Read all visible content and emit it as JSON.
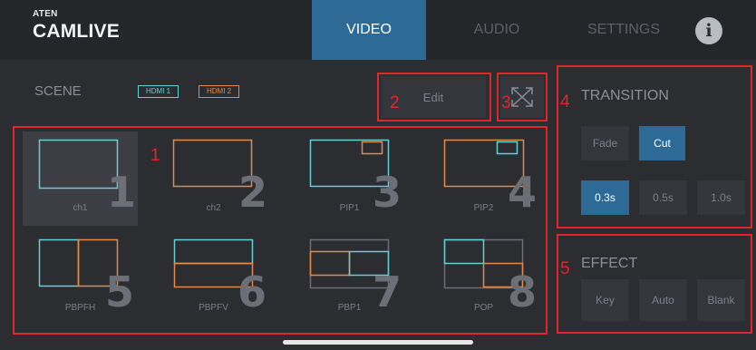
{
  "app": {
    "brand_small": "ATEN",
    "brand_name": "CAMLIVE"
  },
  "tabs": [
    {
      "label": "VIDEO",
      "active": true
    },
    {
      "label": "AUDIO",
      "active": false
    },
    {
      "label": "SETTINGS",
      "active": false
    }
  ],
  "info_icon": {
    "glyph": "i",
    "icon": "info-icon"
  },
  "scene": {
    "label": "SCENE",
    "sources": [
      {
        "label": "HDMI 1",
        "color": "#62d0d6"
      },
      {
        "label": "HDMI 2",
        "color": "#e38a4a"
      }
    ]
  },
  "edit_button": {
    "label": "Edit"
  },
  "expand_button": {
    "icon": "expand-arrows-icon"
  },
  "scenes": [
    {
      "number": "1",
      "label": "ch1",
      "selected": true,
      "layout": "full-hdmi1"
    },
    {
      "number": "2",
      "label": "ch2",
      "selected": false,
      "layout": "full-hdmi2"
    },
    {
      "number": "3",
      "label": "PIP1",
      "selected": false,
      "layout": "pip1"
    },
    {
      "number": "4",
      "label": "PIP2",
      "selected": false,
      "layout": "pip2"
    },
    {
      "number": "5",
      "label": "PBPFH",
      "selected": false,
      "layout": "pbp-full-horizontal"
    },
    {
      "number": "6",
      "label": "PBPFV",
      "selected": false,
      "layout": "pbp-full-vertical"
    },
    {
      "number": "7",
      "label": "PBP1",
      "selected": false,
      "layout": "pbp1"
    },
    {
      "number": "8",
      "label": "POP",
      "selected": false,
      "layout": "pop"
    }
  ],
  "transition": {
    "title": "TRANSITION",
    "modes": [
      {
        "label": "Fade",
        "active": false
      },
      {
        "label": "Cut",
        "active": true
      }
    ],
    "durations": [
      {
        "label": "0.3s",
        "active": true
      },
      {
        "label": "0.5s",
        "active": false
      },
      {
        "label": "1.0s",
        "active": false
      }
    ]
  },
  "effect": {
    "title": "EFFECT",
    "buttons": [
      {
        "label": "Key"
      },
      {
        "label": "Auto"
      },
      {
        "label": "Blank"
      }
    ]
  },
  "callouts": [
    "1",
    "2",
    "3",
    "4",
    "5"
  ],
  "colors": {
    "accent": "#2e6a96",
    "callout": "#e1252c",
    "hdmi1": "#62d0d6",
    "hdmi2": "#e38a4a"
  }
}
